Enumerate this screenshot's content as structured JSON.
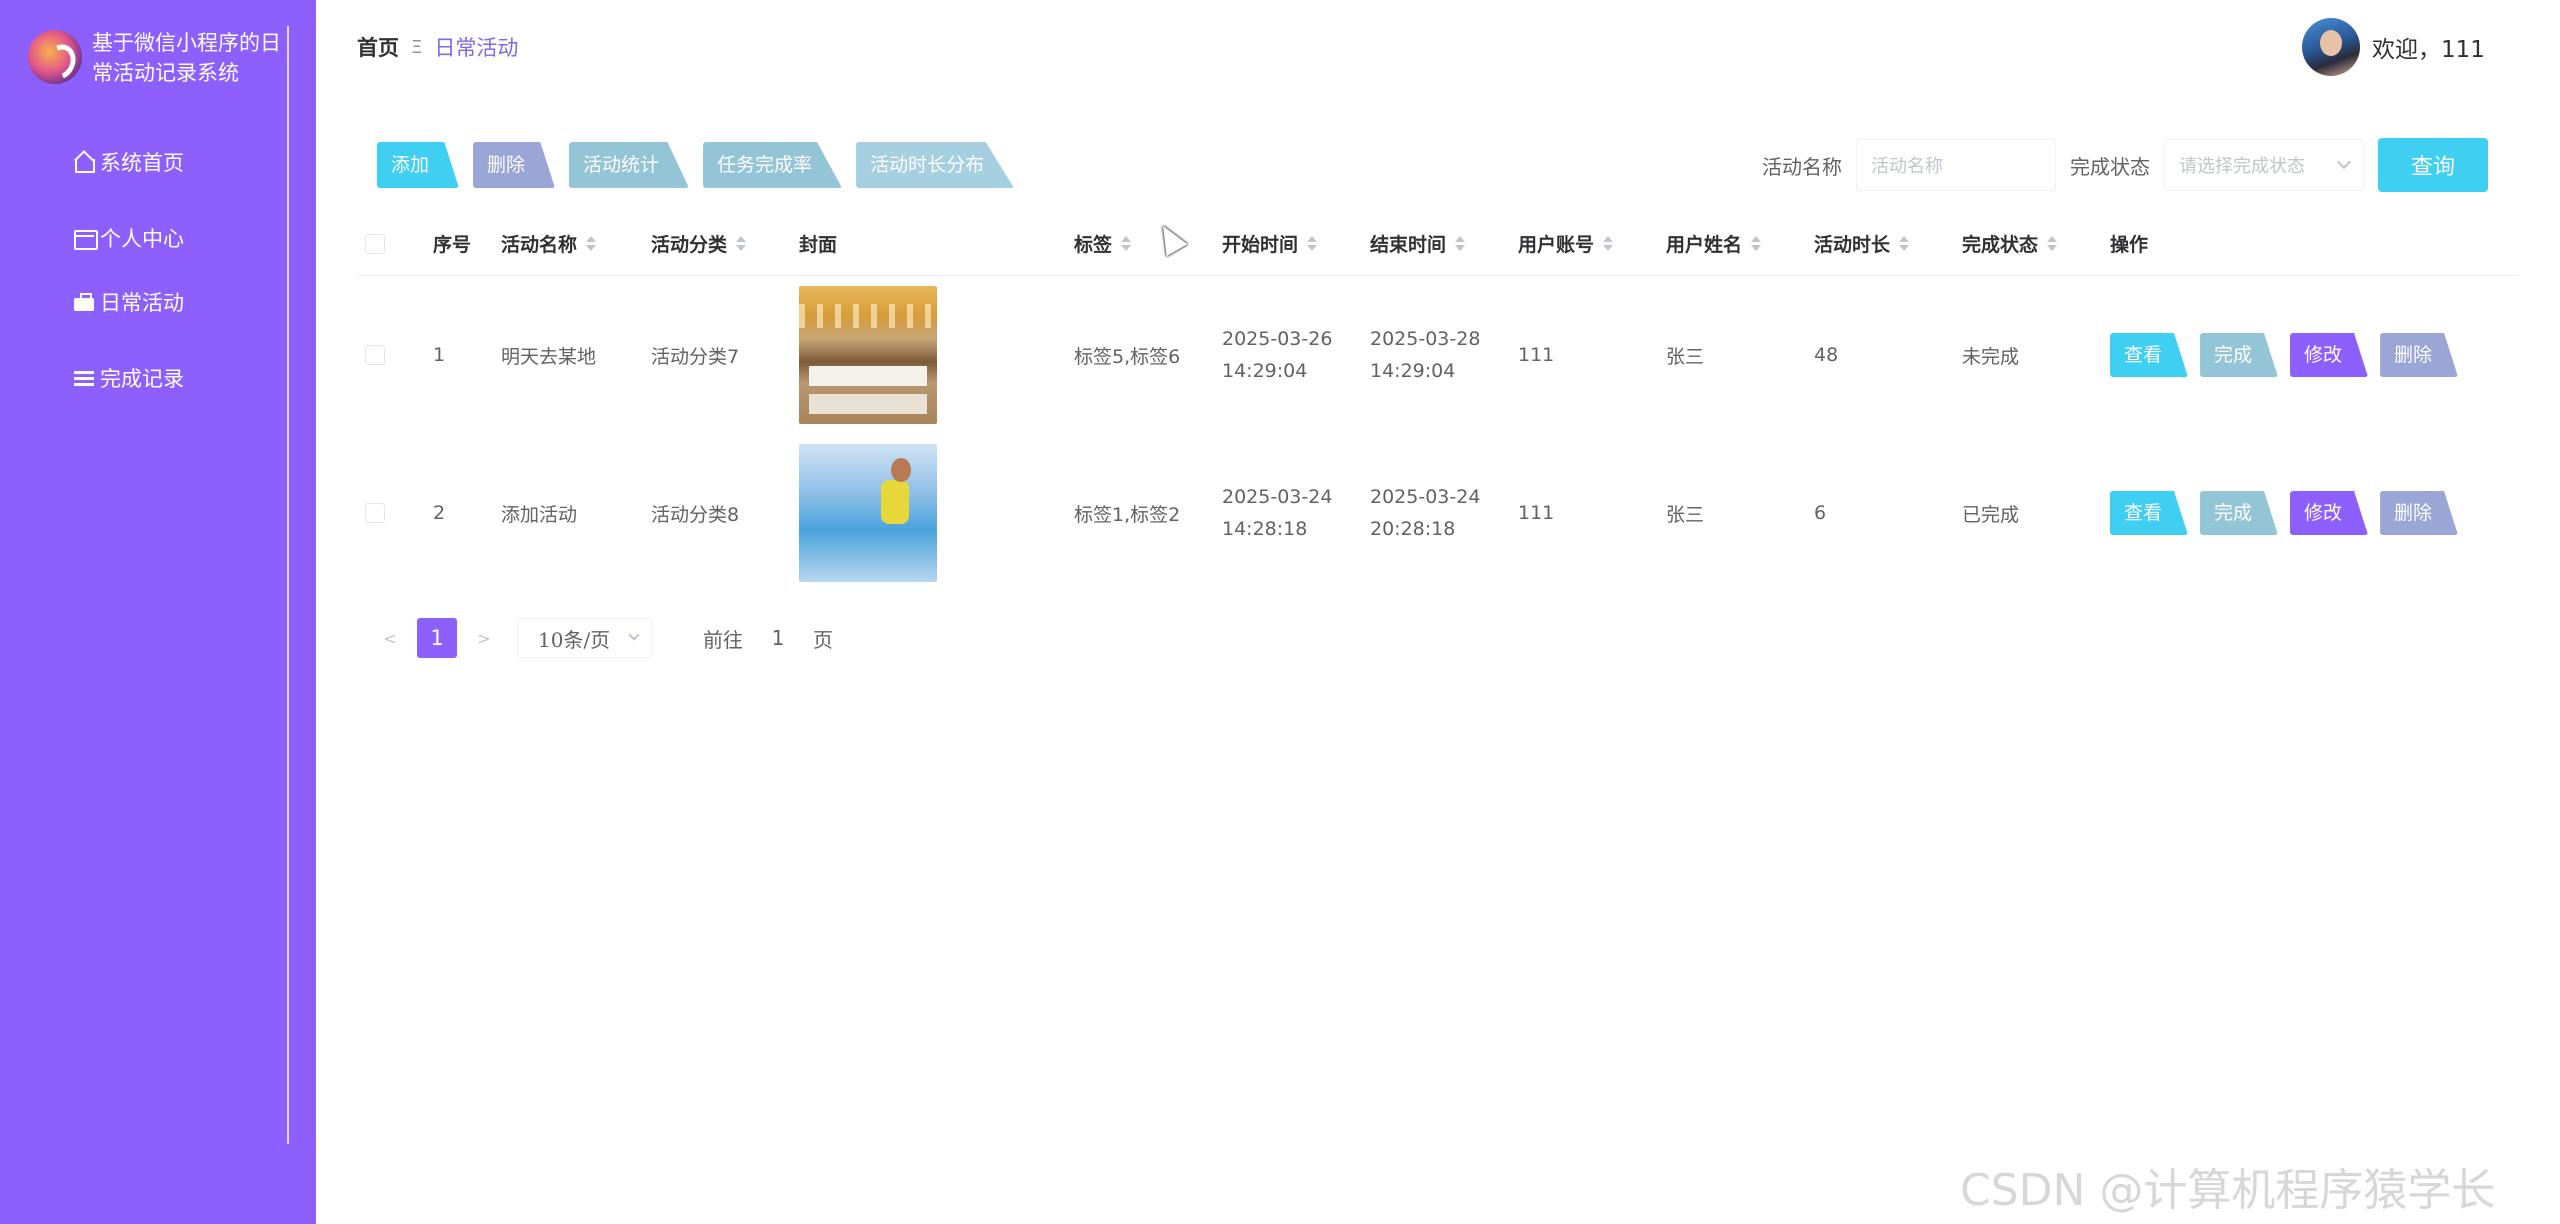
{
  "sidebar": {
    "title": "基于微信小程序的日常活动记录系统",
    "items": [
      {
        "label": "系统首页",
        "icon": "home-icon"
      },
      {
        "label": "个人中心",
        "icon": "card-icon"
      },
      {
        "label": "日常活动",
        "icon": "briefcase-icon"
      },
      {
        "label": "完成记录",
        "icon": "list-icon"
      }
    ]
  },
  "header": {
    "breadcrumb_home": "首页",
    "breadcrumb_sep": "Ξ",
    "breadcrumb_current": "日常活动",
    "welcome": "欢迎，111"
  },
  "toolbar": {
    "add": "添加",
    "delete": "删除",
    "stats": "活动统计",
    "rate": "任务完成率",
    "duration": "活动时长分布"
  },
  "search": {
    "name_label": "活动名称",
    "name_placeholder": "活动名称",
    "status_label": "完成状态",
    "status_placeholder": "请选择完成状态",
    "query": "查询"
  },
  "table": {
    "columns": [
      "序号",
      "活动名称",
      "活动分类",
      "封面",
      "标签",
      "开始时间",
      "结束时间",
      "用户账号",
      "用户姓名",
      "活动时长",
      "完成状态",
      "操作"
    ],
    "rows": [
      {
        "index": "1",
        "name": "明天去某地",
        "category": "活动分类7",
        "tags": "标签5,标签6",
        "start": "2025-03-26 14:29:04",
        "end": "2025-03-28 14:29:04",
        "account": "111",
        "user": "张三",
        "duration": "48",
        "status": "未完成"
      },
      {
        "index": "2",
        "name": "添加活动",
        "category": "活动分类8",
        "tags": "标签1,标签2",
        "start": "2025-03-24 14:28:18",
        "end": "2025-03-24 20:28:18",
        "account": "111",
        "user": "张三",
        "duration": "6",
        "status": "已完成"
      }
    ],
    "ops": {
      "view": "查看",
      "done": "完成",
      "edit": "修改",
      "delete": "删除"
    }
  },
  "pager": {
    "prev": "<",
    "current": "1",
    "next": ">",
    "page_size": "10条/页",
    "goto_prefix": "前往",
    "goto_value": "1",
    "goto_suffix": "页"
  },
  "watermark": "CSDN @计算机程序猿学长",
  "colors": {
    "sidebar": "#8d5ffc",
    "primary_cyan": "#3fcff2",
    "edit_purple": "#8d5ffc",
    "delete_gray_blue": "#9aa6d6"
  }
}
